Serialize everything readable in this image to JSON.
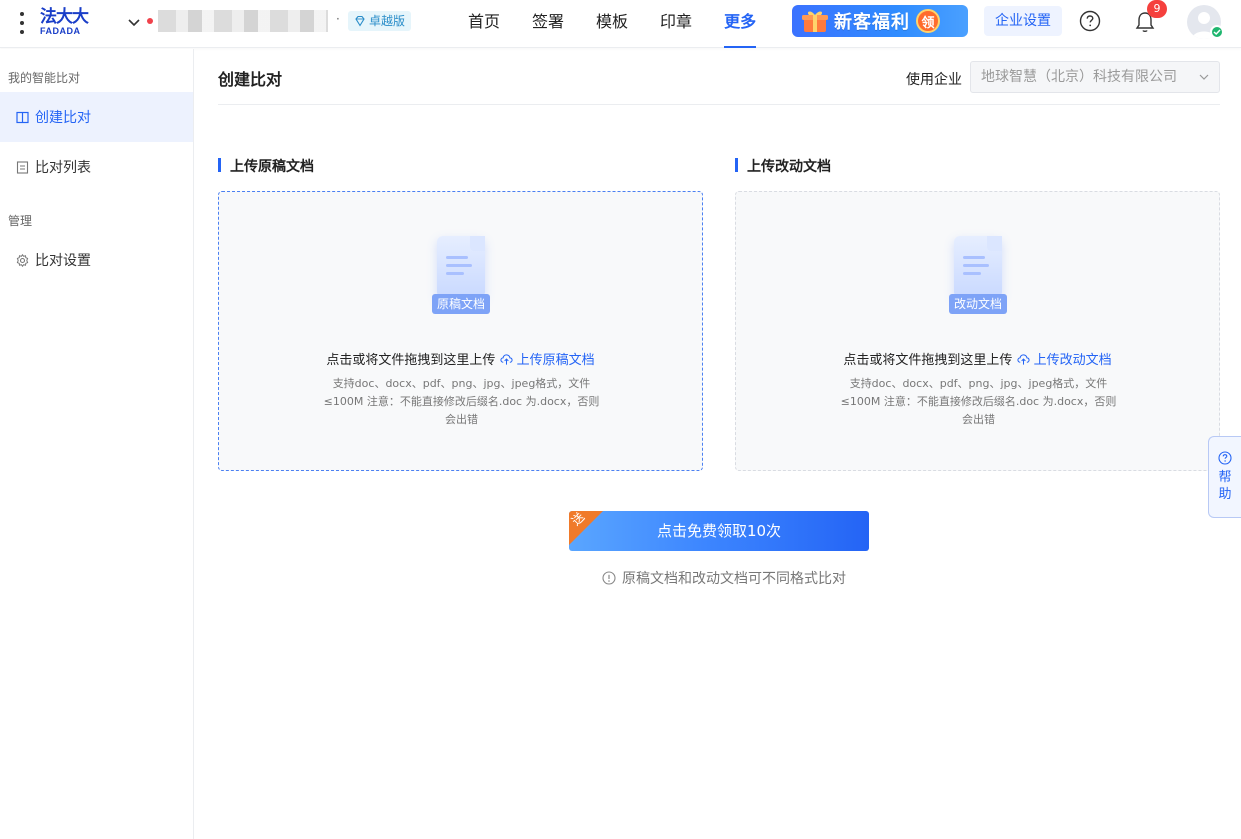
{
  "header": {
    "logo_cn": "法大大",
    "logo_en": "FADADA",
    "org_separator": "·",
    "tier_badge": "卓越版",
    "nav": [
      {
        "label": "首页",
        "active": false
      },
      {
        "label": "签署",
        "active": false
      },
      {
        "label": "模板",
        "active": false
      },
      {
        "label": "印章",
        "active": false
      },
      {
        "label": "更多",
        "active": true
      }
    ],
    "promo_text": "新客福利",
    "promo_claim": "领",
    "enterprise_settings": "企业设置",
    "notification_count": "9",
    "accent_color": "#2464f5"
  },
  "sidebar": {
    "group1": "我的智能比对",
    "item_create": "创建比对",
    "item_list": "比对列表",
    "group2": "管理",
    "item_settings": "比对设置"
  },
  "main": {
    "title": "创建比对",
    "enterprise_label": "使用企业",
    "enterprise_value": "地球智慧（北京）科技有限公司",
    "original": {
      "section_title": "上传原稿文档",
      "doc_tag": "原稿文档",
      "hint": "点击或将文件拖拽到这里上传",
      "link": "上传原稿文档",
      "sub": "支持doc、docx、pdf、png、jpg、jpeg格式，文件≤100M 注意：不能直接修改后缀名.doc 为.docx，否则会出错"
    },
    "revised": {
      "section_title": "上传改动文档",
      "doc_tag": "改动文档",
      "hint": "点击或将文件拖拽到这里上传",
      "link": "上传改动文档",
      "sub": "支持doc、docx、pdf、png、jpg、jpeg格式，文件≤100M 注意：不能直接修改后缀名.doc 为.docx，否则会出错"
    },
    "cta_label": "点击免费领取10次",
    "cta_ribbon": "送",
    "note": "原稿文档和改动文档可不同格式比对"
  },
  "float_help": "帮助"
}
